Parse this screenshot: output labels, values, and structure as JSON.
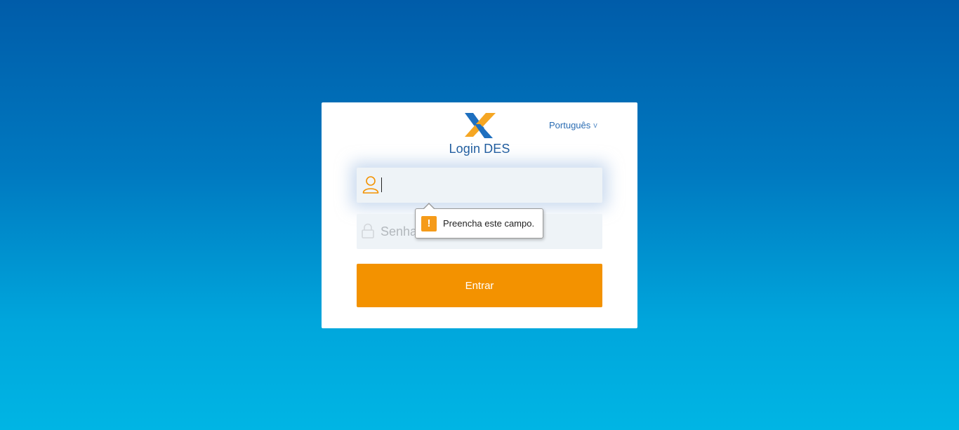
{
  "login": {
    "title": "Login DES",
    "language": {
      "selected": "Português",
      "chevron": "v"
    },
    "username": {
      "value": "",
      "icon": "user-icon",
      "icon_color": "#f39200"
    },
    "password": {
      "placeholder": "Senha",
      "icon": "lock-icon"
    },
    "submit_label": "Entrar",
    "colors": {
      "accent": "#f39200",
      "brand_blue": "#1f5c9e",
      "logo_blue": "#1e6fbf",
      "logo_orange": "#f5a623"
    }
  },
  "validation_tooltip": {
    "icon": "warning-icon",
    "icon_glyph": "!",
    "message": "Preencha este campo."
  }
}
